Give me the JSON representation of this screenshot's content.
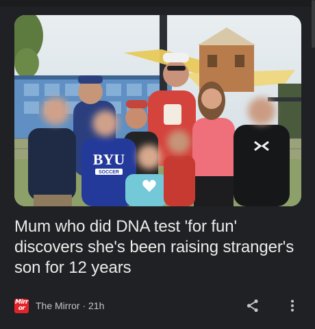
{
  "article": {
    "headline": "Mum who did DNA test 'for fun' discovers she's been raising stranger's son for 12 years",
    "image_alt": "Family photo of two adults and several children outdoors",
    "shirt_text_byu": "BYU",
    "shirt_text_soccer": "SOCCER"
  },
  "source": {
    "logo_line1": "Mirr",
    "logo_line2": "or",
    "publisher": "The Mirror",
    "separator": " · ",
    "age": "21h"
  },
  "actions": {
    "share_icon": "share-icon",
    "more_icon": "more-vertical-icon"
  },
  "colors": {
    "background": "#202124",
    "headline": "#ececec",
    "meta": "#c4c6c9",
    "logo_red": "#e0242a"
  }
}
